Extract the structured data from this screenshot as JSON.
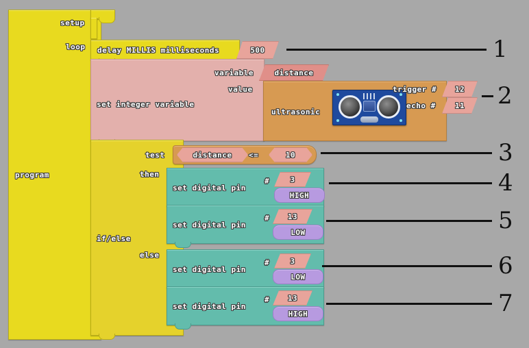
{
  "canvas": {
    "background": "#a8a8a8"
  },
  "program": {
    "label": "program",
    "slots": {
      "setup": "setup",
      "loop": "loop"
    }
  },
  "blocks": {
    "delay": {
      "label": "delay MILLIS  milliseconds",
      "value": "500"
    },
    "set_variable": {
      "label": "set integer variable",
      "variable_label": "variable",
      "variable_value": "distance",
      "value_label": "value"
    },
    "ultrasonic": {
      "label": "ultrasonic",
      "trigger_label": "trigger #",
      "trigger_value": "12",
      "echo_label": "echo #",
      "echo_value": "11",
      "icon": "ultrasonic-sensor-image"
    },
    "if_else": {
      "label": "if/else",
      "test_label": "test",
      "then_label": "then",
      "else_label": "else",
      "condition": {
        "left": "distance",
        "operator": "<=",
        "right": "10"
      }
    },
    "actions": [
      {
        "label": "set digital pin",
        "pin_hash": "#",
        "pin": "3",
        "state": "HIGH",
        "branch": "then"
      },
      {
        "label": "set digital pin",
        "pin_hash": "#",
        "pin": "13",
        "state": "LOW",
        "branch": "then"
      },
      {
        "label": "set digital pin",
        "pin_hash": "#",
        "pin": "3",
        "state": "LOW",
        "branch": "else"
      },
      {
        "label": "set digital pin",
        "pin_hash": "#",
        "pin": "13",
        "state": "HIGH",
        "branch": "else"
      }
    ]
  },
  "annotations": [
    {
      "number": "1"
    },
    {
      "number": "2"
    },
    {
      "number": "3"
    },
    {
      "number": "4"
    },
    {
      "number": "5"
    },
    {
      "number": "6"
    },
    {
      "number": "7"
    }
  ],
  "colors": {
    "yellow": "#e8da1f",
    "pink": "#e3b0ac",
    "orange": "#d79a52",
    "teal": "#63bcac",
    "purple": "#b79ae0",
    "salmon": "#e8a49b",
    "background": "#a8a8a8"
  }
}
